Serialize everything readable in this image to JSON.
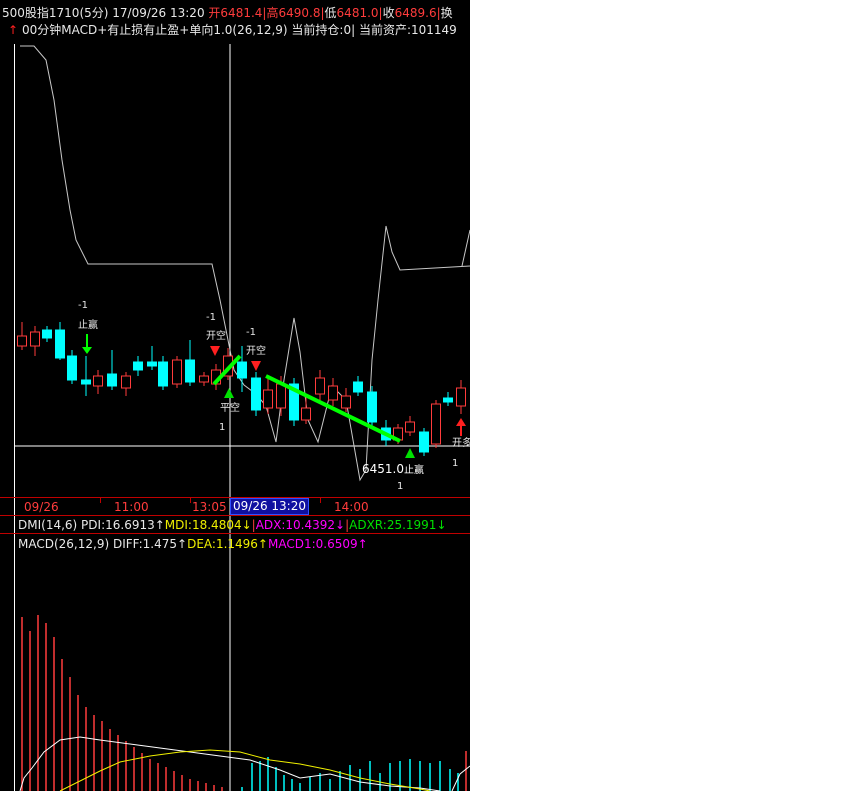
{
  "header": {
    "symbol": "500股指1710(5分)",
    "datetime": "17/09/26 13:20",
    "open_label": "开",
    "open": "6481.4",
    "high_label": "高",
    "high": "6490.8",
    "low_label": "低",
    "low": "6481.0",
    "close_label": "收",
    "close": "6489.6",
    "change_label": "换"
  },
  "strategy": {
    "arrow": "↑",
    "text": "00分钟MACD+有止损有止盈+单向1.0(26,12,9) 当前持仓:0| 当前资产:101149"
  },
  "time_axis": {
    "labels": [
      "09/26",
      "11:00",
      "13:05",
      "14:00"
    ],
    "cursor_label": "09/26  13:20"
  },
  "dmi": {
    "name": "DMI(14,6)",
    "pdi": "PDI:16.6913↑",
    "mdi": "MDI:18.4804↓",
    "adx": "ADX:10.4392↓",
    "adxr": "ADXR:25.1991↓"
  },
  "macd": {
    "name": "MACD(26,12,9)",
    "diff": "DIFF:1.475↑",
    "dea": "DEA:1.1496↑",
    "macd1": "MACD1:0.6509↑"
  },
  "signals": {
    "stop_short": "止赢",
    "open_short_1": "开空",
    "open_short_2": "开空",
    "close_short": "平空",
    "stop_win_2": "止赢",
    "open_long": "开多",
    "minus_one": "-1",
    "one": "1"
  },
  "price_marker": "6451.0",
  "colors": {
    "up": "#ff3c3c",
    "down": "#00ffff",
    "signal": "#00ff00",
    "axis": "#c00000"
  }
}
